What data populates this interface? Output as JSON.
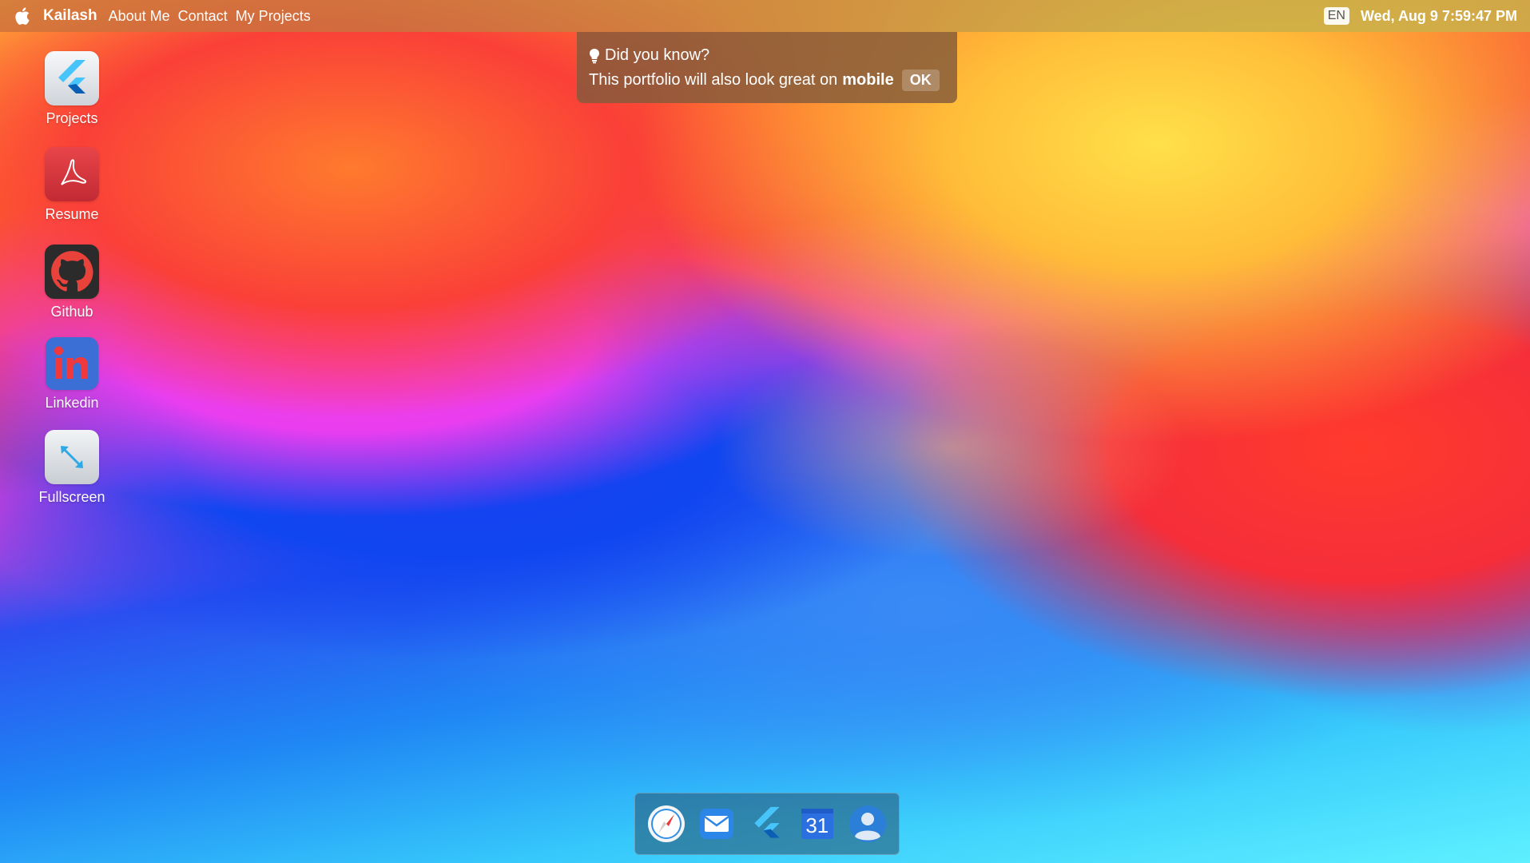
{
  "menubar": {
    "apple_icon": "apple-icon",
    "brand": "Kailash",
    "items": [
      {
        "label": "About Me"
      },
      {
        "label": "Contact"
      },
      {
        "label": "My Projects"
      }
    ],
    "language": "EN",
    "datetime": "Wed, Aug 9 7:59:47 PM"
  },
  "desktop_icons": [
    {
      "label": "Projects",
      "icon": "flutter-icon"
    },
    {
      "label": "Resume",
      "icon": "acrobat-pdf-icon"
    },
    {
      "label": "Github",
      "icon": "github-icon"
    },
    {
      "label": "Linkedin",
      "icon": "linkedin-icon"
    },
    {
      "label": "Fullscreen",
      "icon": "fullscreen-icon"
    }
  ],
  "toast": {
    "icon": "lightbulb-icon",
    "title": "Did you know?",
    "message": "This portfolio will also look great on",
    "emphasis": "mobile",
    "ok_label": "OK"
  },
  "dock": {
    "items": [
      {
        "icon": "safari-compass-icon"
      },
      {
        "icon": "mail-icon"
      },
      {
        "icon": "flutter-icon"
      },
      {
        "icon": "calendar-icon",
        "text": "31"
      },
      {
        "icon": "contacts-icon"
      }
    ]
  },
  "colors": {
    "toast_bg": "#825a3c",
    "dock_bg": "#28506e",
    "flutter_light": "#47c5fb",
    "flutter_dark": "#0a5fb4",
    "linkedin_blue": "#3b6fd6",
    "acrobat_red": "#d8343a"
  }
}
